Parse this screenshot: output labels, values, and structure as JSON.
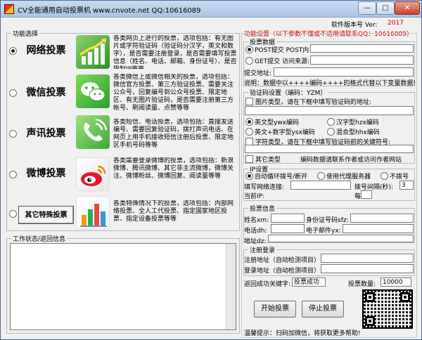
{
  "window": {
    "title": "CV全能通用自动投票机   www.cnvote.net   QQ:10616089",
    "btn_min": "—",
    "btn_max": "□",
    "btn_close": "✕"
  },
  "version": {
    "label": "软件版本号 Ver:",
    "value": "2017"
  },
  "function_select": {
    "legend": "功能选择",
    "items": [
      {
        "label": "网络投票",
        "selected": true,
        "icon": "chart-up-icon",
        "desc": "各类网页上进行的投票，选项包括：有无图片或字符验证码（验证码分汉字，英文和数字），是否需要注册登录，是否需要填写投票信息（姓名、电话、邮箱、身份证号）、是否限制IP等等"
      },
      {
        "label": "微信投票",
        "selected": false,
        "icon": "wechat-icon",
        "desc": "各类微信上或微信相关的投票，选项包括：微信官方投票、第三方验证投票、需要关注公众号，回复编号到公众号投票、限定地区、有无图片验证码，是否需要注册第三方帐号、刷阅读量、点赞等等"
      },
      {
        "label": "声讯投票",
        "selected": false,
        "icon": "phone-icon",
        "desc": "各类短信、电话投票，选项包括：直接发送编号、需要回复验证码，拨打声讯电话、在网页上用手机接收短信注册后投票、限定地区手机号码等等"
      },
      {
        "label": "微博投票",
        "selected": false,
        "icon": "weibo-icon",
        "desc": "各类需要登录微博的投票，选项包括：新浪微博、腾讯微博、其它非主流微博，微博关注、微博粉丝、微博回复、阅读量等等"
      },
      {
        "label": "其它特殊投票",
        "selected": false,
        "icon": "bar-chart-icon",
        "desc": "各类特殊情况下的投票，选项包括：内部网络投票、全人工代投票、指定国家地区投票、指定设备投票等等"
      }
    ]
  },
  "work_status": {
    "legend": "工作状态/返回信息"
  },
  "settings": {
    "legend": "功能设置（以下参数不懂或不适用请联系QQ：10616089）",
    "vote_data": {
      "legend": "投票数据",
      "post_label": "POST提交 POST内",
      "get_label": "GET提交 访问来源:",
      "post_selected": true,
      "addr_label": "提交地址:",
      "note": "说明：数据中以++++编码++++的格式代替以下变量数据!"
    },
    "captcha": {
      "legend": "验证码设置（编码：YZM）",
      "image_label": "图片类型，请在下框中填写验证码的地址:",
      "types": [
        {
          "label": "英文型ywx编码",
          "selected": true
        },
        {
          "label": "汉字型hzx编码",
          "selected": false
        },
        {
          "label": "英文+数字型ysx编码",
          "selected": false
        },
        {
          "label": "混合型hhx编码",
          "selected": false
        }
      ],
      "char_label": "字符类型，请在下框中填写验证码前的关键符号:",
      "other_label": "其它类型",
      "other_note": "编码数据请联系作者或访问作者网站"
    },
    "ip": {
      "legend": "IP设置",
      "options": [
        {
          "label": "自动循环拨号/断开",
          "selected": true
        },
        {
          "label": "使用代理服务器",
          "selected": false
        },
        {
          "label": "不拨号",
          "selected": false
        }
      ],
      "network_label": "填写网络连接:",
      "interval_label": "拨号间隔(秒):",
      "interval_value": "3",
      "interval_suffix": "每1",
      "current_ip_label": "当前IP:"
    },
    "vote_info": {
      "legend": "投票信息",
      "name_label": "姓名xm:",
      "id_label": "身份证号码sfz:",
      "phone_label": "电话dh:",
      "email_label": "电子邮件yx:",
      "addr_label": "地址dz:"
    },
    "register": {
      "legend": "注册登录",
      "reg_label": "注册地址（自动检测项目）:",
      "login_label": "登录地址（自动检测项目）:"
    },
    "success_label": "返回成功关键字:",
    "success_value": "投票成功",
    "count_label": "投票数量:",
    "count_value": "10000",
    "start_button": "开始投票",
    "stop_button": "停止投票",
    "tip": "温馨提示：扫码加微信，将获取更多帮助!"
  }
}
